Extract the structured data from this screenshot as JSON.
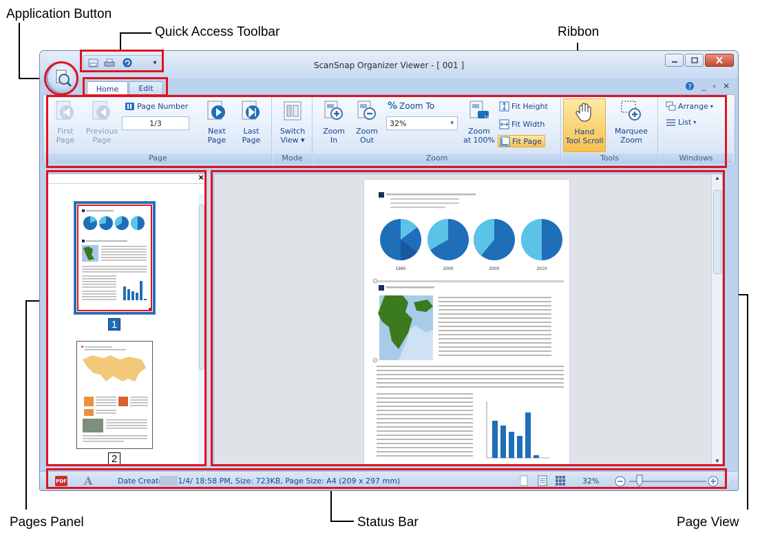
{
  "callouts": {
    "application_button": "Application Button",
    "quick_access_toolbar": "Quick Access Toolbar",
    "ribbon": "Ribbon",
    "pages_panel": "Pages Panel",
    "status_bar": "Status Bar",
    "page_view": "Page View"
  },
  "window": {
    "title": "ScanSnap Organizer Viewer - [ 001 ]",
    "controls": [
      "minimize-icon",
      "maximize-icon",
      "close-icon"
    ]
  },
  "quick_access_toolbar": {
    "icons": [
      "save-icon",
      "print-icon",
      "rotate-icon",
      "customize-dropdown-icon"
    ]
  },
  "tabs": [
    {
      "label": "Home",
      "active": true
    },
    {
      "label": "Edit",
      "active": false
    }
  ],
  "ribbon": {
    "page": {
      "label": "Page",
      "first_page": "First\nPage",
      "previous_page": "Previous\nPage",
      "page_number_label": "Page Number",
      "page_number_value": "1/3",
      "next_page": "Next\nPage",
      "last_page": "Last\nPage"
    },
    "mode": {
      "label": "Mode",
      "switch_view": "Switch\nView ▾"
    },
    "zoom": {
      "label": "Zoom",
      "zoom_in": "Zoom\nIn",
      "zoom_out": "Zoom\nOut",
      "zoom_to_label": "Zoom To",
      "zoom_to_value": "32%",
      "zoom_100": "Zoom\nat 100%",
      "zoom_100_badge": "100",
      "fit_height": "Fit Height",
      "fit_width": "Fit Width",
      "fit_page": "Fit Page"
    },
    "tools": {
      "label": "Tools",
      "hand_tool": "Hand\nTool Scroll",
      "marquee_zoom": "Marquee\nZoom"
    },
    "windows": {
      "label": "Windows",
      "arrange": "Arrange",
      "list": "List"
    }
  },
  "pages_panel": {
    "thumbnails": [
      {
        "number": "1",
        "selected": true
      },
      {
        "number": "2",
        "selected": false
      }
    ]
  },
  "document": {
    "pie_years": [
      "1995",
      "2000",
      "2005",
      "2010"
    ],
    "colors": {
      "dark_blue": "#1f6eb8",
      "light_blue": "#5bc3e8",
      "navy": "#14305f"
    }
  },
  "status_bar": {
    "info": "Date Created: 11/4/       18:58 PM, Size: 723KB, Page Size: A4 (209 x 297 mm)",
    "zoom": "32%"
  },
  "colors": {
    "callout_red": "#e0131d",
    "window_frame": "#bcd2ee",
    "active_tool": "#f8c150"
  }
}
